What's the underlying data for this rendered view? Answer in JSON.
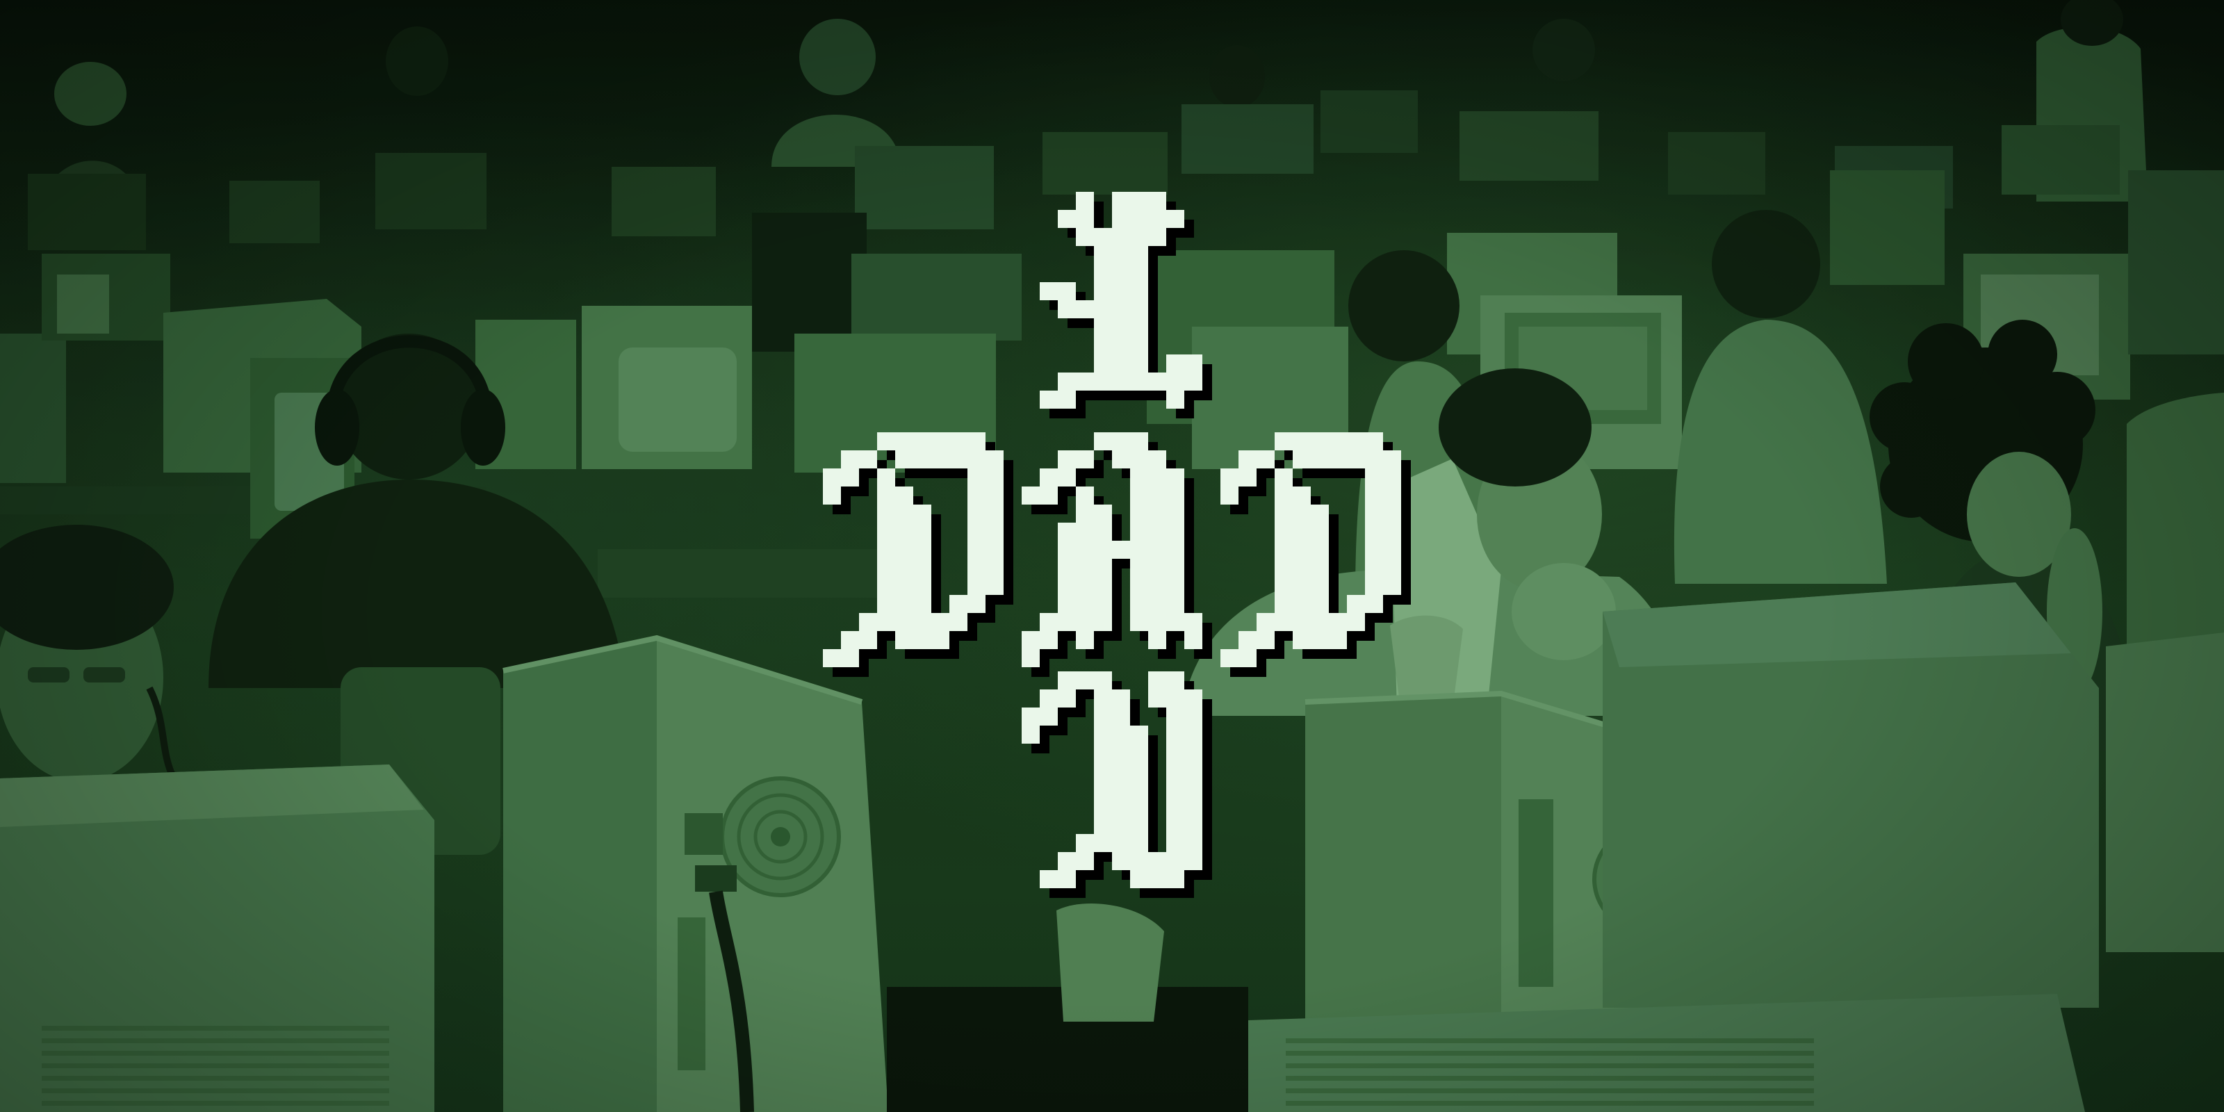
{
  "logo": {
    "top": "L",
    "cross": "DAD",
    "bottom": "N"
  },
  "colors": {
    "tint": "#1e4a22",
    "logo_fill": "#eaf7ea",
    "logo_shadow": "#000000"
  }
}
